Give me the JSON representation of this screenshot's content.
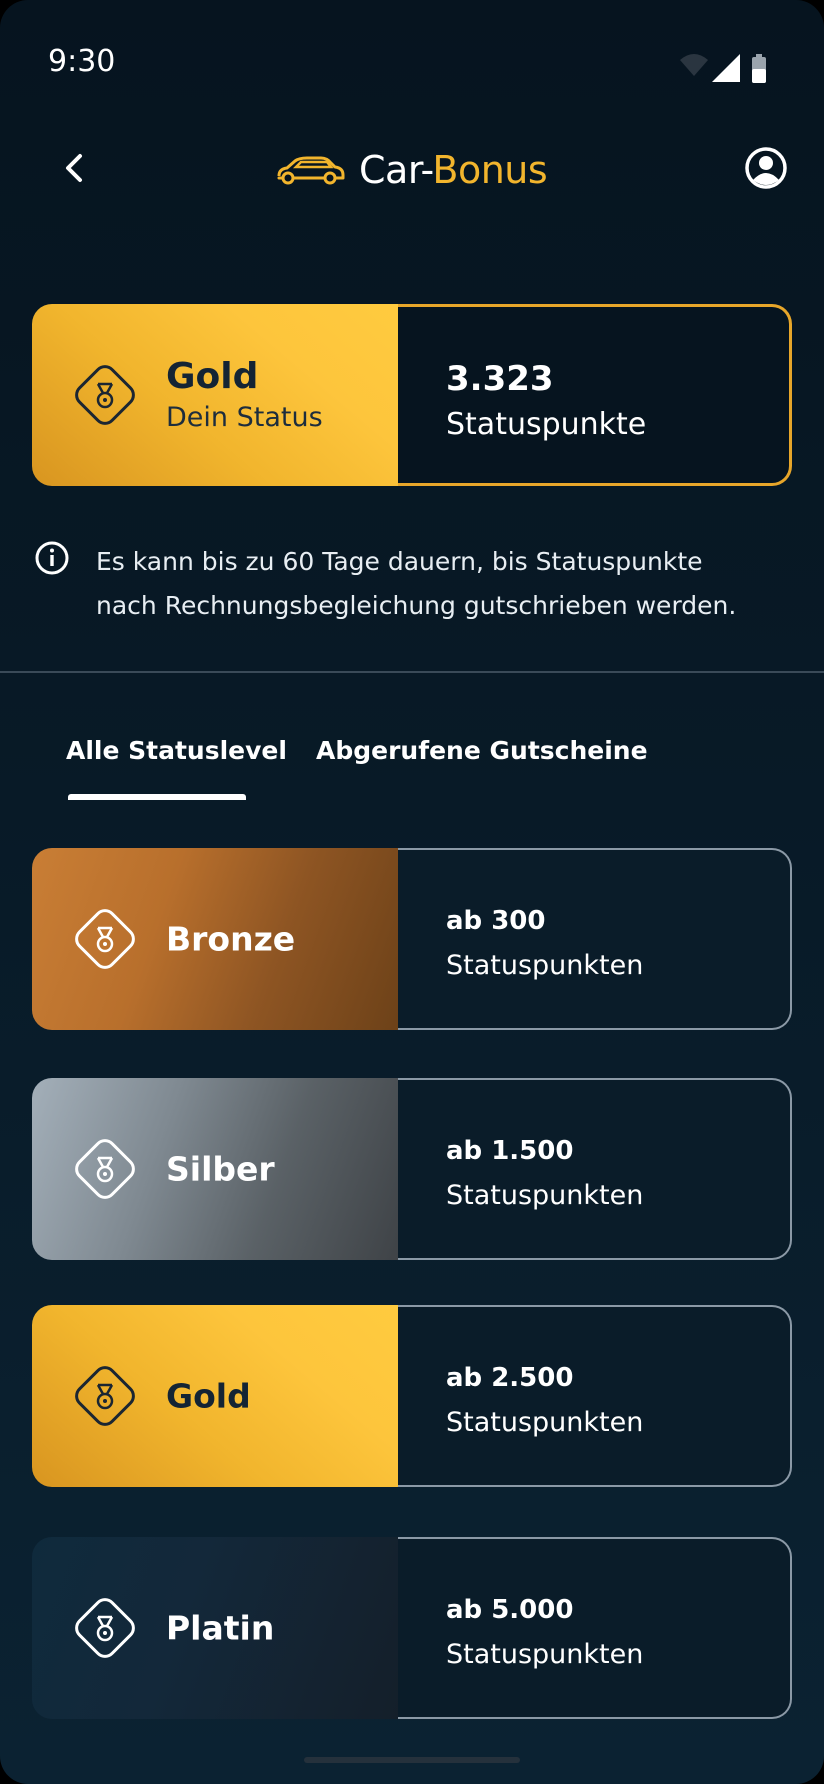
{
  "statusbar": {
    "time": "9:30"
  },
  "header": {
    "logo_part1": "Car-",
    "logo_part2": "Bonus"
  },
  "status": {
    "title": "Gold",
    "subtitle": "Dein Status",
    "points": "3.323",
    "points_label": "Statuspunkte"
  },
  "info": {
    "line1": "Es kann bis zu 60 Tage dauern, bis Statuspunkte",
    "line2": "nach Rechnungsbegleichung gutschrieben werden."
  },
  "tabs": [
    {
      "label": "Alle Statuslevel",
      "active": true
    },
    {
      "label": "Abgerufene Gutscheine",
      "active": false
    }
  ],
  "levels": [
    {
      "name": "Bronze",
      "from": "ab 300",
      "unit": "Statuspunkten"
    },
    {
      "name": "Silber",
      "from": "ab 1.500",
      "unit": "Statuspunkten"
    },
    {
      "name": "Gold",
      "from": "ab 2.500",
      "unit": "Statuspunkten"
    },
    {
      "name": "Platin",
      "from": "ab 5.000",
      "unit": "Statuspunkten"
    }
  ],
  "colors": {
    "accent_gold": "#f2b52d",
    "background": "#06141f",
    "card_border": "#8b99a6"
  },
  "icons": {
    "back": "chevron-left-icon",
    "logo": "car-icon",
    "profile": "account-circle-icon",
    "info": "info-icon",
    "medal": "medal-icon"
  }
}
